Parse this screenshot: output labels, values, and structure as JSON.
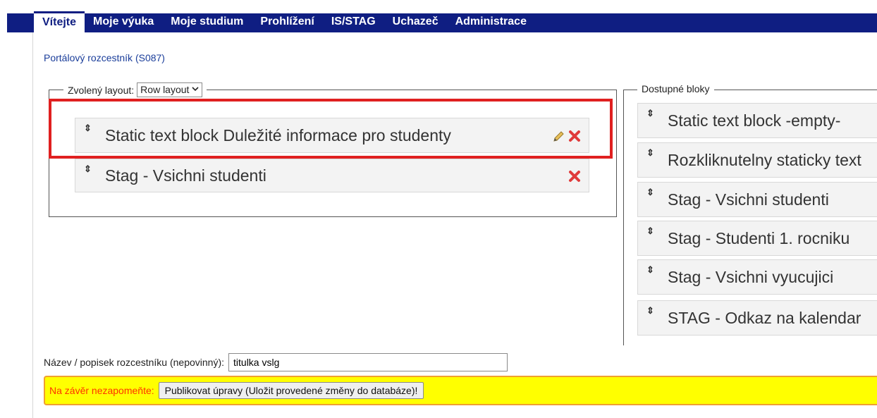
{
  "nav": {
    "tabs": [
      {
        "label": "Vítejte",
        "active": true
      },
      {
        "label": "Moje výuka"
      },
      {
        "label": "Moje studium"
      },
      {
        "label": "Prohlížení"
      },
      {
        "label": "IS/STAG"
      },
      {
        "label": "Uchazeč"
      },
      {
        "label": "Administrace"
      }
    ]
  },
  "page": {
    "title": "Portálový rozcestník (S087)"
  },
  "layout_panel": {
    "legend_label": "Zvolený layout:",
    "layout_select_value": "Row layout",
    "blocks": [
      {
        "label": "Static text block Duležité informace pro studenty",
        "editable": true
      },
      {
        "label": "Stag - Vsichni studenti",
        "editable": false
      }
    ]
  },
  "available_panel": {
    "legend_label": "Dostupné bloky",
    "blocks": [
      {
        "label": "Static text block -empty-"
      },
      {
        "label": "Rozkliknutelny staticky text"
      },
      {
        "label": "Stag - Vsichni studenti"
      },
      {
        "label": "Stag - Studenti 1. rocniku"
      },
      {
        "label": "Stag - Vsichni vyucujici"
      },
      {
        "label": "STAG - Odkaz na kalendar"
      }
    ]
  },
  "form": {
    "name_label": "Název / popisek rozcestníku (nepovinný):",
    "name_value": "titulka vslg"
  },
  "notice": {
    "label": "Na závěr nezapomeňte:",
    "publish_button": "Publikovat úpravy (Uložit provedené změny do databáze)!"
  },
  "icons": {
    "drag": "drag-handle-icon",
    "edit": "pencil-icon",
    "remove": "delete-x-icon"
  },
  "colors": {
    "nav_bg": "#0f1e82",
    "highlight": "#e02020",
    "notice_bg": "#ffff00",
    "notice_text": "#ff3300"
  }
}
